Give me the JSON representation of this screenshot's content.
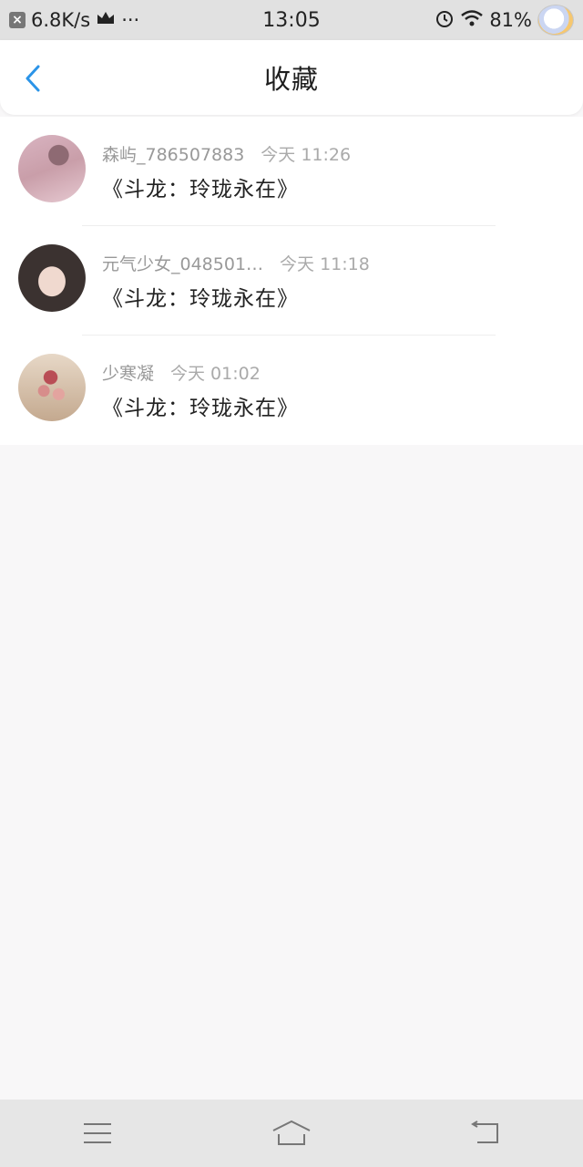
{
  "status_bar": {
    "network_speed": "6.8K/s",
    "dots": "···",
    "time": "13:05",
    "battery": "81%"
  },
  "header": {
    "title": "收藏"
  },
  "favorites": [
    {
      "username": "森屿_786507883",
      "time": "今天 11:26",
      "title": "《斗龙：玲珑永在》"
    },
    {
      "username": "元气少女_048501…",
      "time": "今天 11:18",
      "title": "《斗龙：玲珑永在》"
    },
    {
      "username": "少寒凝",
      "time": "今天 01:02",
      "title": "《斗龙：玲珑永在》"
    }
  ],
  "colors": {
    "accent": "#2b94e8"
  }
}
